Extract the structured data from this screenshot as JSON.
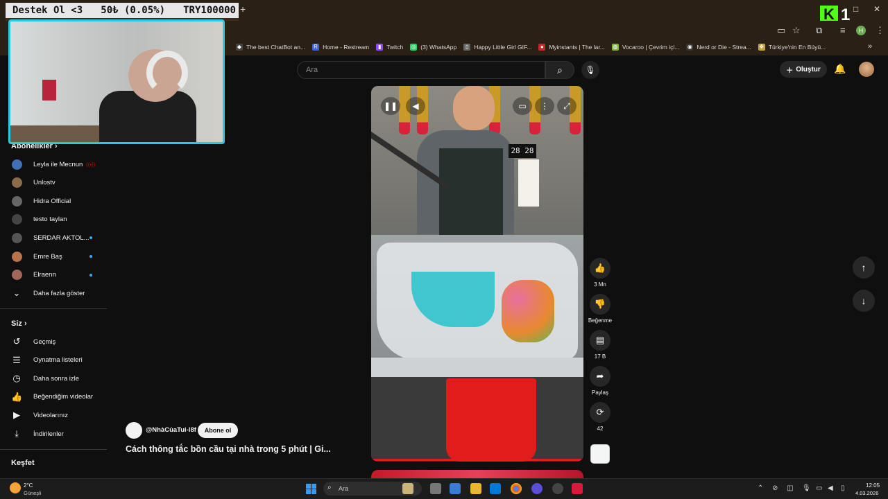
{
  "overlay": {
    "message": "Destek Ol <3",
    "amount": "50₺ (0.05%)",
    "goal": "TRY100000"
  },
  "kick": {
    "logo": "K",
    "count": "1"
  },
  "browser": {
    "new_tab": "+",
    "window_controls": [
      "–",
      "□",
      "✕"
    ],
    "toolbar_icons": [
      "cast-icon",
      "star-icon",
      "extensions-icon",
      "media-icon",
      "profile-icon",
      "menu-icon"
    ],
    "profile_initial": "H",
    "bookmarks": [
      {
        "label": "The best ChatBot an...",
        "icon": "◆",
        "color": "#444444"
      },
      {
        "label": "Home - Restream",
        "icon": "R",
        "color": "#3a66d6"
      },
      {
        "label": "Twitch",
        "icon": "▮",
        "color": "#9146ff"
      },
      {
        "label": "(3) WhatsApp",
        "icon": "◎",
        "color": "#25d366"
      },
      {
        "label": "Happy Little Girl GIF...",
        "icon": "▯",
        "color": "#666666"
      },
      {
        "label": "Myinstants | The lar...",
        "icon": "●",
        "color": "#c62828"
      },
      {
        "label": "Vocaroo | Çevrim içi...",
        "icon": "◍",
        "color": "#7cb342"
      },
      {
        "label": "Nerd or Die - Strea...",
        "icon": "◉",
        "color": "#333333"
      },
      {
        "label": "Türkiye'nin En Büyü...",
        "icon": "❖",
        "color": "#c7a43b"
      }
    ],
    "more_bookmarks": "»"
  },
  "youtube": {
    "search": {
      "placeholder": "Ara"
    },
    "create_label": "Oluştur",
    "sidebar": {
      "subscriptions_title": "Abonelikler",
      "subscriptions": [
        {
          "name": "Leyla ile Mecnun",
          "badge": "live",
          "color": "#3f6fb5"
        },
        {
          "name": "Unlostv",
          "badge": "",
          "color": "#8a6b4a"
        },
        {
          "name": "Hidra Official",
          "badge": "",
          "color": "#666666"
        },
        {
          "name": "testo taylan",
          "badge": "",
          "color": "#444444"
        },
        {
          "name": "SERDAR AKTOL...",
          "badge": "dot",
          "color": "#555555"
        },
        {
          "name": "Emre Baş",
          "badge": "dot",
          "color": "#b8734a"
        },
        {
          "name": "Elraenn",
          "badge": "dot",
          "color": "#a0675a"
        }
      ],
      "show_more": "Daha fazla göster",
      "you_title": "Siz",
      "you_items": [
        {
          "label": "Geçmiş",
          "icon": "history-icon"
        },
        {
          "label": "Oynatma listeleri",
          "icon": "playlists-icon"
        },
        {
          "label": "Daha sonra izle",
          "icon": "watch-later-icon"
        },
        {
          "label": "Beğendiğim videolar",
          "icon": "liked-icon"
        },
        {
          "label": "Videolarınız",
          "icon": "your-videos-icon"
        },
        {
          "label": "İndirilenler",
          "icon": "downloads-icon"
        }
      ],
      "explore_title": "Keşfet"
    },
    "short": {
      "channel": "@NhàCủaTui-l8f",
      "subscribe_label": "Abone ol",
      "title": "Cách thông tắc bồn cầu tại nhà trong 5 phút | Gi...",
      "clock_display": "28 28",
      "actions": {
        "likes": "3 Mn",
        "dislike_label": "Beğenme",
        "comments": "17 B",
        "share_label": "Paylaş",
        "remix": "42"
      }
    }
  },
  "taskbar": {
    "weather_temp": "2°C",
    "weather_desc": "Güneşli",
    "search_placeholder": "Ara",
    "time": "12:05",
    "date": "4.03.2026"
  }
}
